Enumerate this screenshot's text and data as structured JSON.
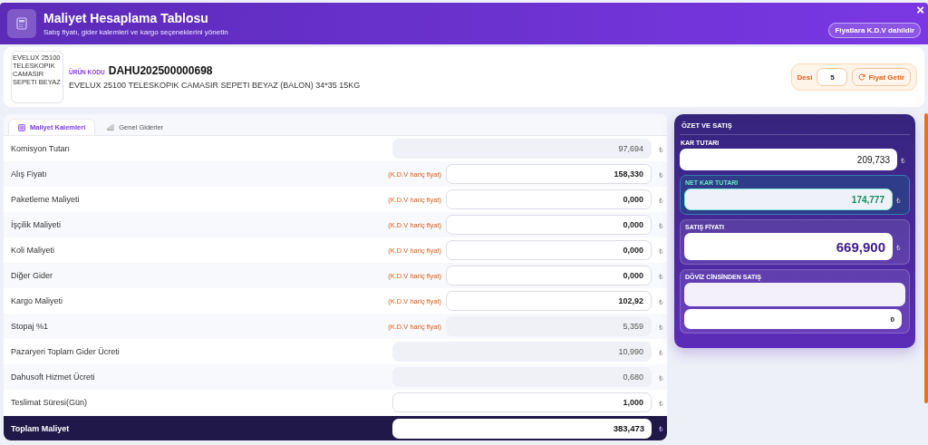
{
  "header": {
    "title": "Maliyet Hesaplama Tablosu",
    "subtitle": "Satış fiyatı, gider kalemleri ve kargo seçeneklerini yönetin",
    "badge": "Fiyatlara K.D.V dahildir",
    "close": "×"
  },
  "product": {
    "image_alt": "EVELUX 25100 TELESKOPIK CAMASIR SEPETI BEYAZ",
    "code_label": "ÜRÜN KODU",
    "code": "DAHU202500000698",
    "name": "EVELUX 25100 TELESKOPIK CAMASIR SEPETI BEYAZ (BALON) 34*35 15KG",
    "desi_label": "Desi",
    "desi": "5",
    "fetch_button": "Fiyat Getir"
  },
  "tabs": [
    {
      "label": "Maliyet Kalemleri",
      "selected": true
    },
    {
      "label": "Genel Giderler",
      "selected": false
    }
  ],
  "rows": [
    {
      "label": "Komisyon Tutarı",
      "value": "97,694",
      "readonly": true,
      "unit": "₺"
    },
    {
      "label": "Alış Fiyatı",
      "note": "(K.D.V hariç fiyat)",
      "value": "158,330",
      "readonly": false,
      "unit": "₺"
    },
    {
      "label": "Paketleme Maliyeti",
      "note": "(K.D.V hariç fiyat)",
      "value": "0,000",
      "readonly": false,
      "unit": "₺"
    },
    {
      "label": "İşçilik Maliyeti",
      "note": "(K.D.V hariç fiyat)",
      "value": "0,000",
      "readonly": false,
      "unit": "₺"
    },
    {
      "label": "Koli Maliyeti",
      "note": "(K.D.V hariç fiyat)",
      "value": "0,000",
      "readonly": false,
      "unit": "₺"
    },
    {
      "label": "Diğer Gider",
      "note": "(K.D.V hariç fiyat)",
      "value": "0,000",
      "readonly": false,
      "unit": "₺"
    },
    {
      "label": "Kargo Maliyeti",
      "note": "(K.D.V hariç fiyat)",
      "value": "102,92",
      "readonly": false,
      "unit": "₺"
    },
    {
      "label": "Stopaj %1",
      "note": "(K.D.V hariç fiyat)",
      "value": "5,359",
      "readonly": true,
      "unit": "₺"
    },
    {
      "label": "Pazaryeri Toplam Gider Ücreti",
      "value": "10,990",
      "readonly": true,
      "unit": "₺"
    },
    {
      "label": "Dahusoft Hizmet Ücreti",
      "value": "0,680",
      "readonly": true,
      "unit": "₺"
    },
    {
      "label": "Teslimat Süresi(Gün)",
      "value": "1,000",
      "readonly": false,
      "unit": "₺"
    }
  ],
  "total": {
    "label": "Toplam Maliyet",
    "value": "383,473",
    "unit": "₺"
  },
  "summary": {
    "title": "ÖZET VE SATIŞ",
    "sections": [
      {
        "kind": "plain",
        "label": "KAR TUTARI",
        "value": "209,733",
        "unit": "₺"
      },
      {
        "kind": "net",
        "label": "NET KAR TUTARI",
        "value": "174,777",
        "unit": "₺"
      },
      {
        "kind": "sale",
        "label": "SATIŞ FİYATI",
        "value": "669,900",
        "unit": "₺"
      },
      {
        "kind": "currency",
        "label": "DÖVİZ CİNSİNDEN SATIŞ",
        "value": "0"
      }
    ]
  }
}
